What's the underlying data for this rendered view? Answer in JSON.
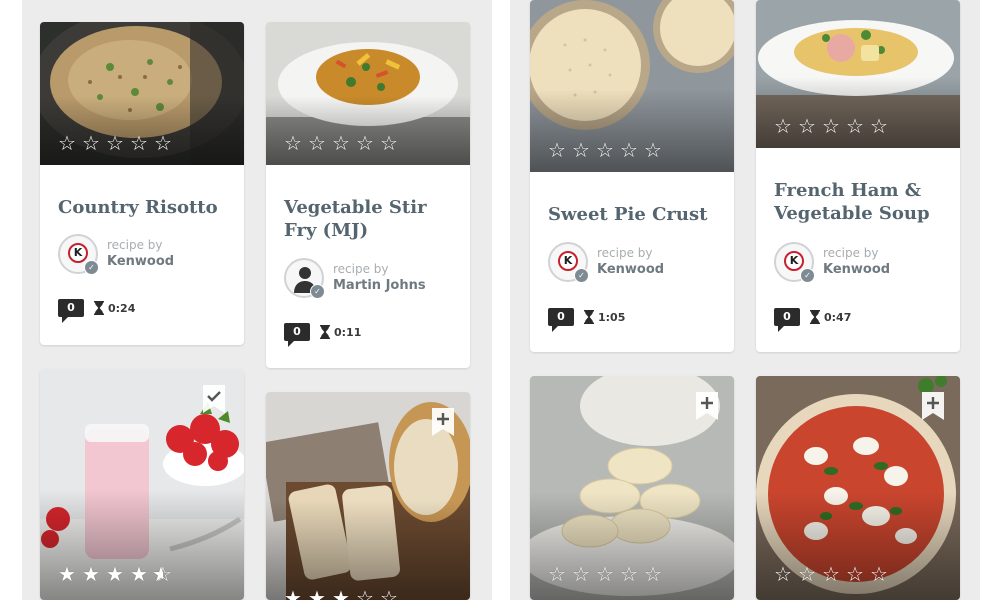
{
  "left_column": {
    "cards": [
      {
        "title": "Country Risotto",
        "author_label": "recipe by",
        "author": "Kenwood",
        "avatar": "kenwood-logo",
        "rating_stars": 0,
        "comments": "0",
        "time": "0:24"
      },
      {
        "title": "Vegetable Stir Fry (MJ)",
        "author_label": "recipe by",
        "author": "Martin Johns",
        "avatar": "person-placeholder",
        "rating_stars": 0,
        "comments": "0",
        "time": "0:11"
      },
      {
        "photo": "strawberry-yogurt",
        "rating_stars": 4.5,
        "saved": true,
        "save_icon": "check-bookmark-icon"
      },
      {
        "photo": "sliced-bread-loaf",
        "rating_stars": 3,
        "saved": false,
        "save_icon": "plus-bookmark-icon"
      }
    ]
  },
  "right_column": {
    "cards": [
      {
        "title": "Sweet Pie Crust",
        "author_label": "recipe by",
        "author": "Kenwood",
        "avatar": "kenwood-logo",
        "rating_stars": 0,
        "comments": "0",
        "time": "1:05"
      },
      {
        "title": "French Ham & Vegetable Soup",
        "author_label": "recipe by",
        "author": "Kenwood",
        "avatar": "kenwood-logo",
        "rating_stars": 0,
        "comments": "0",
        "time": "0:47"
      },
      {
        "photo": "macarons",
        "rating_stars": 0,
        "saved": false,
        "save_icon": "plus-bookmark-icon"
      },
      {
        "photo": "pizza",
        "rating_stars": 0,
        "saved": false,
        "save_icon": "plus-bookmark-icon"
      }
    ]
  },
  "colors": {
    "panel_bg": "#ececec",
    "title_text": "#55656f",
    "author_text": "#6f7a80",
    "badge_bg": "#2b2b2b",
    "brand_red": "#c7202d"
  }
}
